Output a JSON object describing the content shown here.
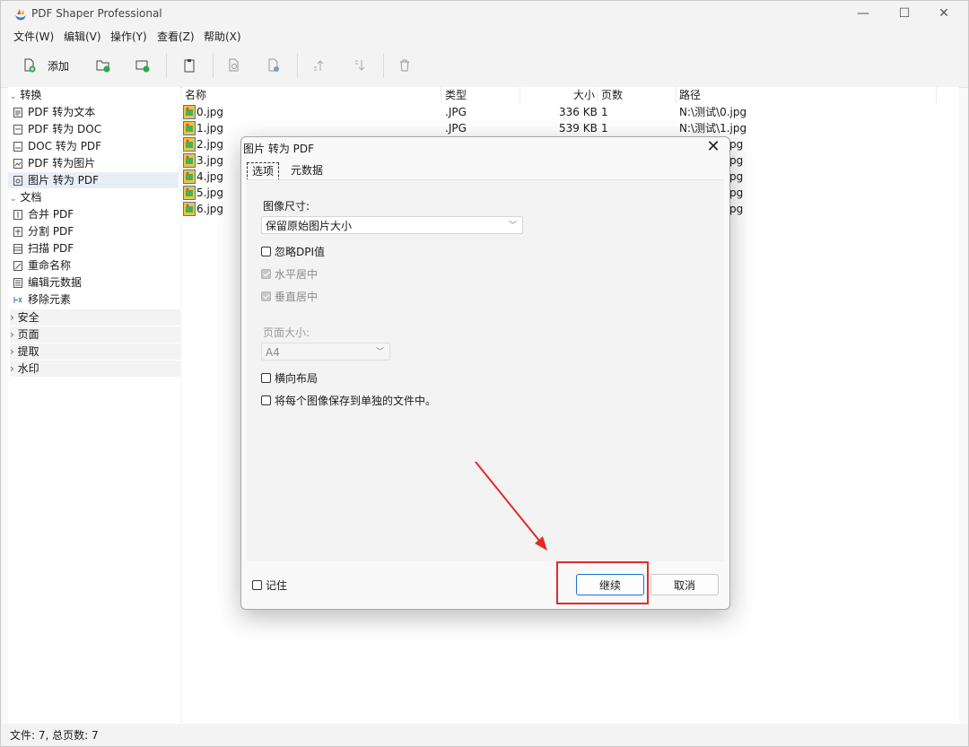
{
  "window": {
    "title": "PDF Shaper Professional",
    "minimize": "—",
    "maximize": "☐",
    "close": "✕"
  },
  "menu": [
    "文件(W)",
    "编辑(V)",
    "操作(Y)",
    "查看(Z)",
    "帮助(X)"
  ],
  "toolbar": {
    "add_label": "添加"
  },
  "sidebar": {
    "convert_group": "转换",
    "convert_items": [
      "PDF 转为文本",
      "PDF 转为 DOC",
      "DOC 转为 PDF",
      "PDF 转为图片",
      "图片 转为 PDF"
    ],
    "document_group": "文档",
    "document_items": [
      "合并 PDF",
      "分割 PDF",
      "扫描 PDF",
      "重命名称",
      "编辑元数据",
      "移除元素"
    ],
    "collapsed_groups": [
      "安全",
      "页面",
      "提取",
      "水印"
    ]
  },
  "filelist": {
    "headers": {
      "name": "名称",
      "type": "类型",
      "size": "大小",
      "pages": "页数",
      "path": "路径"
    },
    "rows": [
      {
        "name": "0.jpg",
        "type": ".JPG",
        "size": "336 KB",
        "pages": "1",
        "path": "N:\\测试\\0.jpg"
      },
      {
        "name": "1.jpg",
        "type": ".JPG",
        "size": "539 KB",
        "pages": "1",
        "path": "N:\\测试\\1.jpg"
      },
      {
        "name": "2.jpg",
        "path_tail": "pg"
      },
      {
        "name": "3.jpg",
        "path_tail": "pg"
      },
      {
        "name": "4.jpg",
        "path_tail": "pg"
      },
      {
        "name": "5.jpg",
        "path_tail": "pg"
      },
      {
        "name": "6.jpg",
        "path_tail": "pg"
      }
    ]
  },
  "status": "文件: 7, 总页数: 7",
  "dialog": {
    "title": "图片 转为 PDF",
    "close": "✕",
    "tabs": [
      "选项",
      "元数据"
    ],
    "image_size_label": "图像尺寸:",
    "image_size_value": "保留原始图片大小",
    "ignore_dpi": "忽略DPI值",
    "center_h": "水平居中",
    "center_v": "垂直居中",
    "page_size_label": "页面大小:",
    "page_size_value": "A4",
    "landscape": "横向布局",
    "separate_files": "将每个图像保存到单独的文件中。",
    "remember": "记住",
    "continue": "继续",
    "cancel": "取消"
  },
  "annotation_color": "#e32a2a"
}
